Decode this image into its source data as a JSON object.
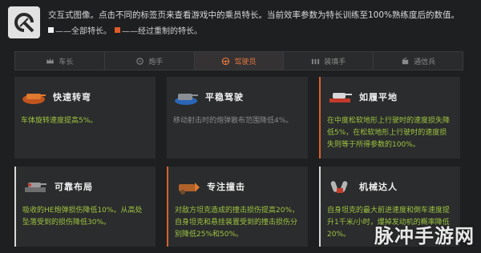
{
  "header": {
    "description": "交互式图像。点击不同的标签页来查看游戏中的乘员特长。当前效率参数为特长训练至100%熟练度后的数值。",
    "legend_all": "——全部特长。",
    "legend_important": "——经过重制的特长。"
  },
  "tabs": [
    {
      "label": "车长",
      "icon": "crown-icon",
      "active": false
    },
    {
      "label": "炮手",
      "icon": "crosshair-icon",
      "active": false
    },
    {
      "label": "驾驶员",
      "icon": "steering-wheel-icon",
      "active": true
    },
    {
      "label": "装填手",
      "icon": "shells-icon",
      "active": false
    },
    {
      "label": "通信兵",
      "icon": "radio-icon",
      "active": false
    }
  ],
  "cards": [
    {
      "title": "快速转弯",
      "text": "车体旋转速度提高5%。",
      "marker": "none",
      "icon": "tank-turn-icon"
    },
    {
      "title": "平稳驾驶",
      "text": "移动射击时的炮弹散布范围降低4%。",
      "marker": "none",
      "icon": "tank-smooth-icon"
    },
    {
      "title": "如履平地",
      "text": "在中度松软地形上行驶时的速度损失降低5%，在松软地形上行驶时的速度损失则等于所得参数的100%。",
      "marker": "orange",
      "icon": "tank-terrain-icon"
    },
    {
      "title": "可靠布局",
      "text": "吸收的HE炮弹损伤降低10%。从高处坠落受到的损伤降低30%。",
      "marker": "white",
      "icon": "tank-layout-icon"
    },
    {
      "title": "专注撞击",
      "text": "对敌方坦克造成的撞击损伤提高20%，自身坦克和悬挂装置受到的撞击损伤分别降低25%和50%。",
      "marker": "orange",
      "icon": "ram-icon"
    },
    {
      "title": "机械达人",
      "text": "自身坦克的最大前进速度和倒车速度提升1千米/小时，爆掉发动机的概率降低20%。",
      "marker": "white",
      "icon": "engine-icon"
    }
  ],
  "watermark": "脉冲手游网",
  "colors": {
    "accent": "#e4773c",
    "bonus_text": "#9cc440"
  }
}
